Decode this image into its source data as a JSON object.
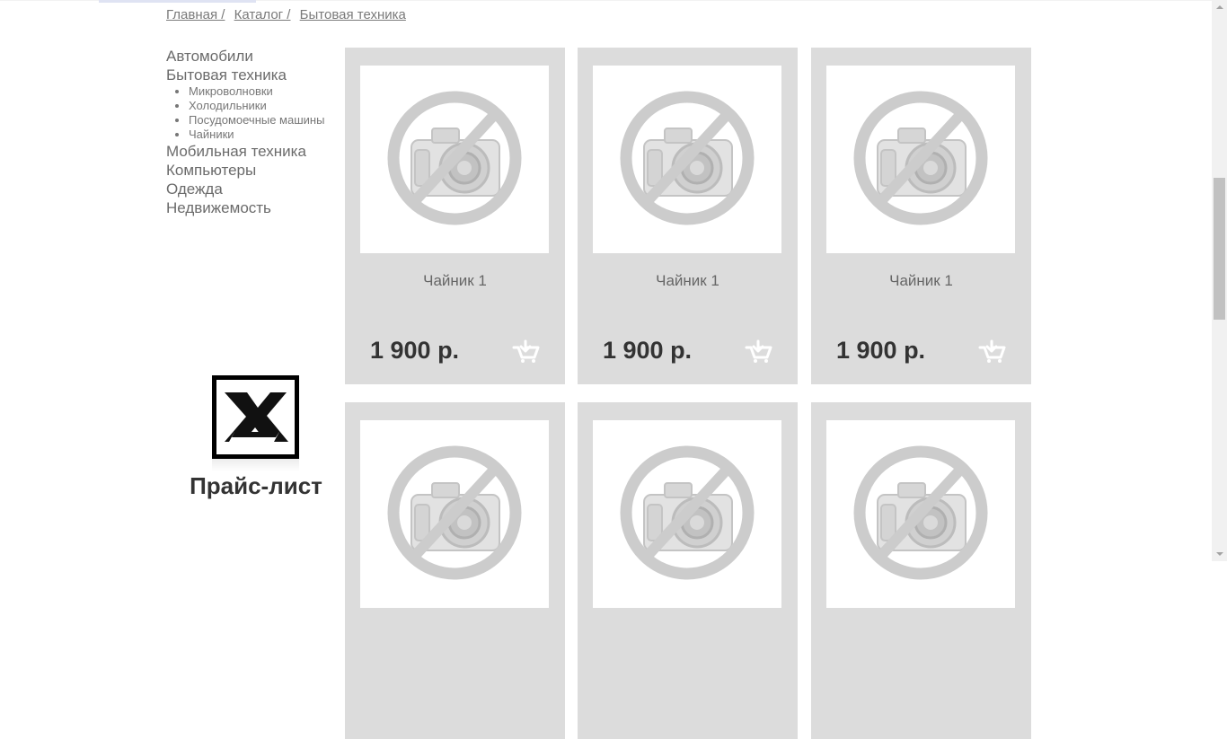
{
  "breadcrumb": {
    "items": [
      "Главная /",
      "Каталог /",
      "Бытовая техника"
    ]
  },
  "sidebar": {
    "categories": [
      {
        "label": "Автомобили"
      },
      {
        "label": "Бытовая техника",
        "subitems": [
          "Микроволновки",
          "Холодильники",
          "Посудомоечные машины",
          "Чайники"
        ]
      },
      {
        "label": "Мобильная техника"
      },
      {
        "label": "Компьютеры"
      },
      {
        "label": "Одежда"
      },
      {
        "label": "Недвижемость"
      }
    ]
  },
  "price_list": {
    "label": "Прайс-лист",
    "logo_letters": "X"
  },
  "products": [
    {
      "name": "Чайник 1",
      "price": "1 900 р.",
      "image_icon": "no-photo-icon",
      "cart_icon": "cart-icon"
    },
    {
      "name": "Чайник 1",
      "price": "1 900 р.",
      "image_icon": "no-photo-icon",
      "cart_icon": "cart-icon"
    },
    {
      "name": "Чайник 1",
      "price": "1 900 р.",
      "image_icon": "no-photo-icon",
      "cart_icon": "cart-icon"
    },
    {
      "name": "",
      "price": "",
      "image_icon": "no-photo-icon"
    },
    {
      "name": "",
      "price": "",
      "image_icon": "no-photo-icon"
    },
    {
      "name": "",
      "price": "",
      "image_icon": "no-photo-icon"
    }
  ],
  "colors": {
    "card_bg": "#dcdcdc",
    "text": "#666666",
    "price": "#333333",
    "cart_icon": "#ffffff"
  }
}
